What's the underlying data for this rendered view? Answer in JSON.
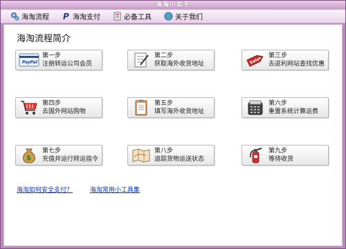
{
  "window": {
    "title": "海淘小助手"
  },
  "toolbar": {
    "items": [
      {
        "label": "海淘流程",
        "icon": "gears-icon"
      },
      {
        "label": "海淘支付",
        "icon": "paypal-icon"
      },
      {
        "label": "必备工具",
        "icon": "tools-icon"
      },
      {
        "label": "关于我们",
        "icon": "globe-icon"
      }
    ]
  },
  "main": {
    "title": "海淘流程简介",
    "steps": [
      {
        "step": "第一步",
        "desc": "注册转运公司会员",
        "icon": "paypal-card-icon"
      },
      {
        "step": "第二步",
        "desc": "获取海外收货地址",
        "icon": "notepad-pen-icon"
      },
      {
        "step": "第三步",
        "desc": "去返利网站查找优惠",
        "icon": "sale-tag-icon"
      },
      {
        "step": "第四步",
        "desc": "去国外网站购物",
        "icon": "shopping-cart-icon"
      },
      {
        "step": "第五步",
        "desc": "填写海外收货地址",
        "icon": "clipboard-icon"
      },
      {
        "step": "第六步",
        "desc": "重置系统计算运费",
        "icon": "calculator-icon"
      },
      {
        "step": "第七步",
        "desc": "充值并运行转运指令",
        "icon": "money-bag-icon"
      },
      {
        "step": "第八步",
        "desc": "追踪货物运送状态",
        "icon": "map-icon"
      },
      {
        "step": "第九步",
        "desc": "等待收货",
        "icon": "fire-extinguisher-icon"
      }
    ],
    "links": [
      "海淘如何安全支付？",
      "海淘常用小工具集"
    ]
  }
}
